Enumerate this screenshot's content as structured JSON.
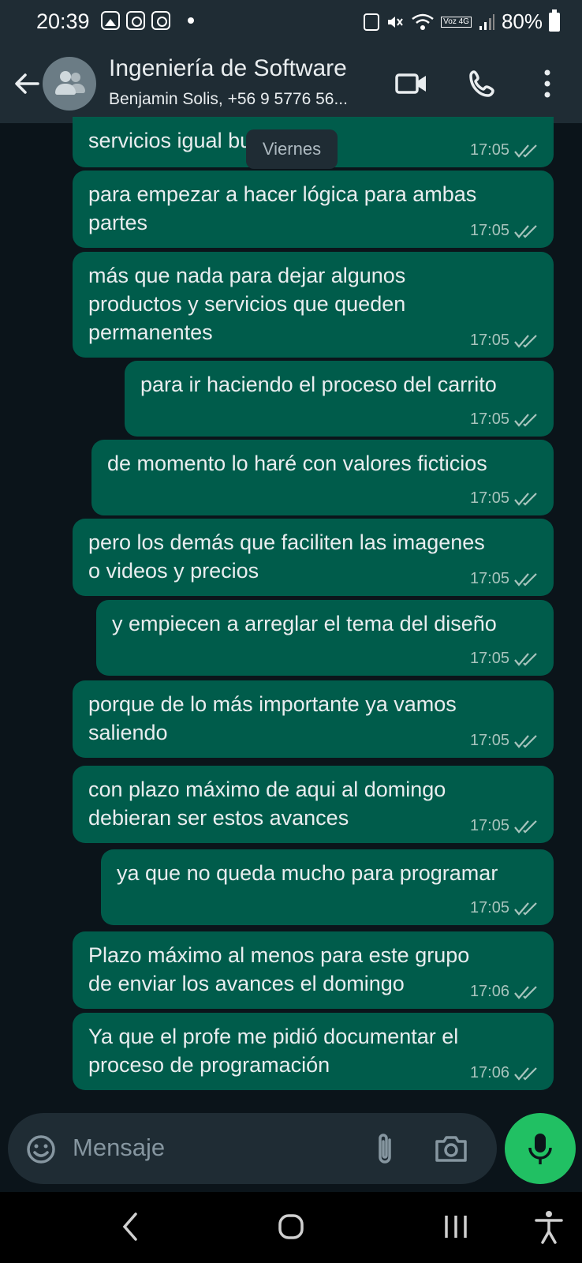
{
  "status_bar": {
    "time": "20:39",
    "net_label": "Voz 4G",
    "battery": "80%"
  },
  "header": {
    "title": "Ingeniería de Software",
    "subtitle": "Benjamin Solis, +56 9 5776 56..."
  },
  "date_chip": "Viernes",
  "messages": [
    {
      "lines": [
        "servicios igual bueno"
      ],
      "time": "17:05"
    },
    {
      "lines": [
        "para empezar a hacer lógica para ambas",
        "partes"
      ],
      "time": "17:05"
    },
    {
      "lines": [
        "más que nada para dejar algunos",
        "productos y servicios que queden",
        "permanentes"
      ],
      "time": "17:05"
    },
    {
      "lines": [
        "para ir haciendo el proceso del carrito"
      ],
      "time": "17:05"
    },
    {
      "lines": [
        "de momento lo haré con valores ficticios"
      ],
      "time": "17:05"
    },
    {
      "lines": [
        "pero los demás que faciliten las imagenes",
        "o videos y precios"
      ],
      "time": "17:05"
    },
    {
      "lines": [
        "y empiecen a arreglar el tema del diseño"
      ],
      "time": "17:05"
    },
    {
      "lines": [
        "porque de lo más importante ya vamos",
        "saliendo"
      ],
      "time": "17:05"
    },
    {
      "lines": [
        "con plazo máximo de aqui al domingo",
        "debieran ser estos avances"
      ],
      "time": "17:05"
    },
    {
      "lines": [
        "ya que no queda mucho para programar"
      ],
      "time": "17:05"
    },
    {
      "lines": [
        "Plazo máximo al menos para este grupo",
        "de enviar los avances el domingo"
      ],
      "time": "17:06"
    },
    {
      "lines": [
        "Ya que el profe me pidió documentar el",
        "proceso de programación"
      ],
      "time": "17:06"
    }
  ],
  "composer": {
    "placeholder": "Mensaje"
  },
  "colors": {
    "outgoing_bubble": "#005c4b",
    "background": "#0b141a",
    "header": "#1f2c34",
    "mic_button": "#21c063",
    "read_ticks": "#a8c4bd"
  },
  "icons": [
    "back-arrow-icon",
    "group-avatar-icon",
    "video-call-icon",
    "phone-icon",
    "more-vert-icon",
    "emoji-icon",
    "attach-icon",
    "camera-icon",
    "mic-icon",
    "double-check-icon"
  ]
}
